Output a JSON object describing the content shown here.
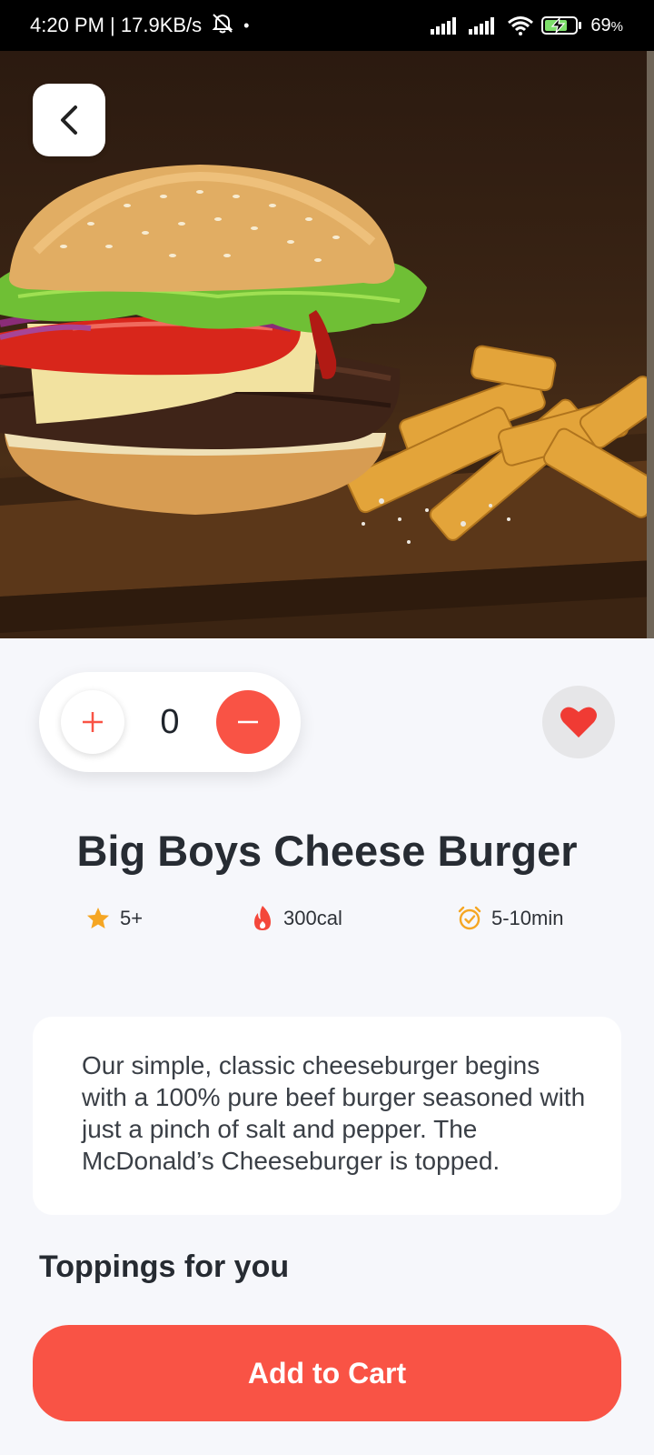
{
  "status_bar": {
    "left_text": "4:20 PM | 17.9KB/s",
    "dot": "•",
    "battery": "69",
    "battery_unit": "%",
    "icons": [
      "mute-bell-icon",
      "signal-icon",
      "signal-icon",
      "wifi-icon",
      "battery-charging-icon"
    ]
  },
  "hero": {
    "image": "burger-and-fries-photo",
    "back_icon": "chevron-left-icon"
  },
  "quantity": {
    "value": "0",
    "plus_icon": "plus-icon",
    "minus_icon": "minus-icon"
  },
  "favorite": {
    "icon": "heart-icon",
    "active": true
  },
  "product": {
    "title": "Big Boys Cheese Burger",
    "stats": {
      "rating": "5+",
      "calories": "300cal",
      "time": "5-10min"
    },
    "description": "Our simple, classic cheeseburger begins with a 100% pure beef burger seasoned with just a pinch of salt and pepper. The McDonald’s Cheeseburger is topped."
  },
  "sections": {
    "toppings_title": "Toppings for you"
  },
  "actions": {
    "add_to_cart": "Add to Cart"
  },
  "colors": {
    "accent": "#f95345",
    "background": "#f6f7fb",
    "star": "#f5a623",
    "title_text": "#272c33"
  }
}
